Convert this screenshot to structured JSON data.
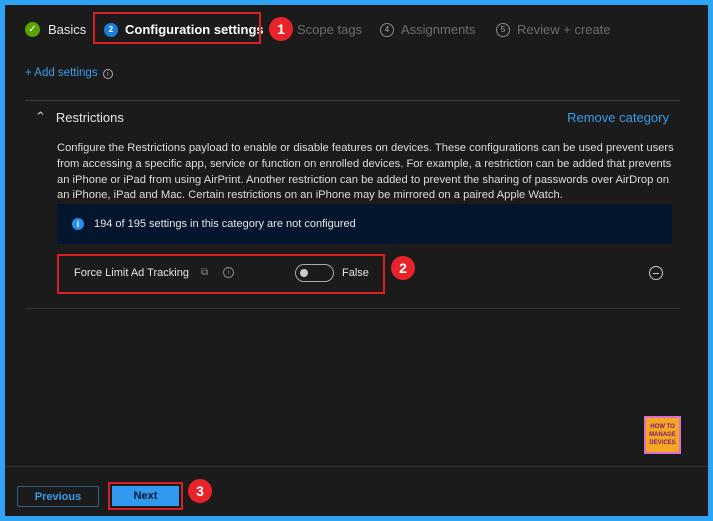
{
  "steps": [
    {
      "label": "Basics",
      "state": "done"
    },
    {
      "number": "2",
      "label": "Configuration settings",
      "state": "current"
    },
    {
      "number": "3",
      "label": "Scope tags"
    },
    {
      "number": "4",
      "label": "Assignments"
    },
    {
      "number": "5",
      "label": "Review + create"
    }
  ],
  "add_settings": "+ Add settings",
  "category": {
    "title": "Restrictions",
    "remove": "Remove category",
    "description": "Configure the Restrictions payload to enable or disable features on devices. These configurations can be used prevent users from accessing a specific app, service or function on enrolled devices. For example, a restriction can be added that prevents an iPhone or iPad from using AirPrint. Another restriction can be added to prevent the sharing of passwords over AirDrop on an iPhone, iPad and Mac. Certain restrictions on an iPhone may be mirrored on a paired Apple Watch.",
    "info": "194 of 195 settings in this category are not configured",
    "setting": {
      "label": "Force Limit Ad Tracking",
      "value": "False"
    }
  },
  "callouts": [
    "1",
    "2",
    "3"
  ],
  "logo": {
    "line1": "HOW TO",
    "line2": "MANAGE",
    "line3": "DEVICES"
  },
  "footer": {
    "previous": "Previous",
    "next": "Next"
  },
  "colors": {
    "accent": "#2fa4f5",
    "link": "#3b9ce8",
    "callout": "#e8242a"
  }
}
